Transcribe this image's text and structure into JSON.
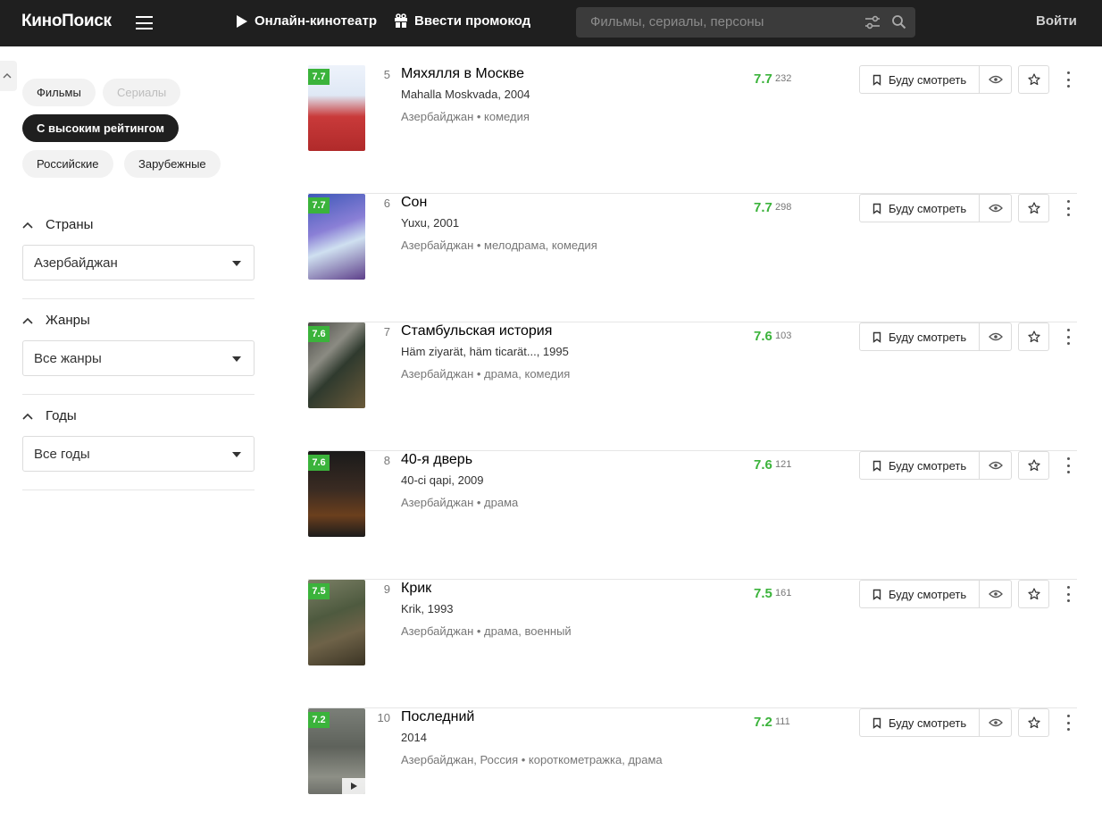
{
  "header": {
    "logo": "КиноПоиск",
    "online_label": "Онлайн-кинотеатр",
    "promo_label": "Ввести промокод",
    "search_placeholder": "Фильмы, сериалы, персоны",
    "login_label": "Войти"
  },
  "sidebar": {
    "chips": {
      "films": "Фильмы",
      "series": "Сериалы",
      "top_rated": "С высоким рейтингом",
      "russian": "Российские",
      "foreign": "Зарубежные"
    },
    "filters": [
      {
        "label": "Страны",
        "value": "Азербайджан"
      },
      {
        "label": "Жанры",
        "value": "Все жанры"
      },
      {
        "label": "Годы",
        "value": "Все годы"
      }
    ]
  },
  "actions": {
    "watch_label": "Буду смотреть"
  },
  "movies": [
    {
      "pos": "5",
      "title": "Мяхялля в Москве",
      "orig": "Mahalla Moskvada, 2004",
      "meta": "Азербайджан • комедия",
      "rating": "7.7",
      "votes": "232"
    },
    {
      "pos": "6",
      "title": "Сон",
      "orig": "Yuxu, 2001",
      "meta": "Азербайджан • мелодрама, комедия",
      "rating": "7.7",
      "votes": "298"
    },
    {
      "pos": "7",
      "title": "Стамбульская история",
      "orig": "Häm ziyarät, häm ticarät..., 1995",
      "meta": "Азербайджан • драма, комедия",
      "rating": "7.6",
      "votes": "103"
    },
    {
      "pos": "8",
      "title": "40-я дверь",
      "orig": "40-ci qapi, 2009",
      "meta": "Азербайджан • драма",
      "rating": "7.6",
      "votes": "121"
    },
    {
      "pos": "9",
      "title": "Крик",
      "orig": "Krik, 1993",
      "meta": "Азербайджан • драма, военный",
      "rating": "7.5",
      "votes": "161"
    },
    {
      "pos": "10",
      "title": "Последний",
      "orig": "2014",
      "meta": "Азербайджан, Россия • короткометражка, драма",
      "rating": "7.2",
      "votes": "111"
    }
  ],
  "colors": {
    "header_bg": "#1f1f1f",
    "rating_green": "#3bb33b",
    "chip_bg": "#f2f2f2",
    "chip_active_bg": "#1f1f1f"
  }
}
